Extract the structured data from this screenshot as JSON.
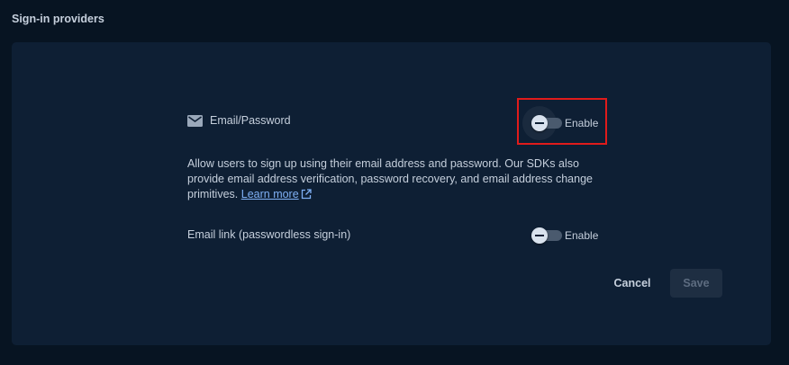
{
  "section": {
    "title": "Sign-in providers"
  },
  "providers": [
    {
      "icon": "mail-icon",
      "label": "Email/Password",
      "toggle_label": "Enable",
      "enabled": false
    },
    {
      "label": "Email link (passwordless sign-in)",
      "toggle_label": "Enable",
      "enabled": false
    }
  ],
  "description": {
    "text": "Allow users to sign up using their email address and password. Our SDKs also provide email address verification, password recovery, and email address change primitives.",
    "link_label": "Learn more"
  },
  "actions": {
    "cancel_label": "Cancel",
    "save_label": "Save"
  },
  "colors": {
    "background": "#071422",
    "card": "#0e1f34",
    "link": "#7fb0f5",
    "highlight": "#e01b1b"
  }
}
